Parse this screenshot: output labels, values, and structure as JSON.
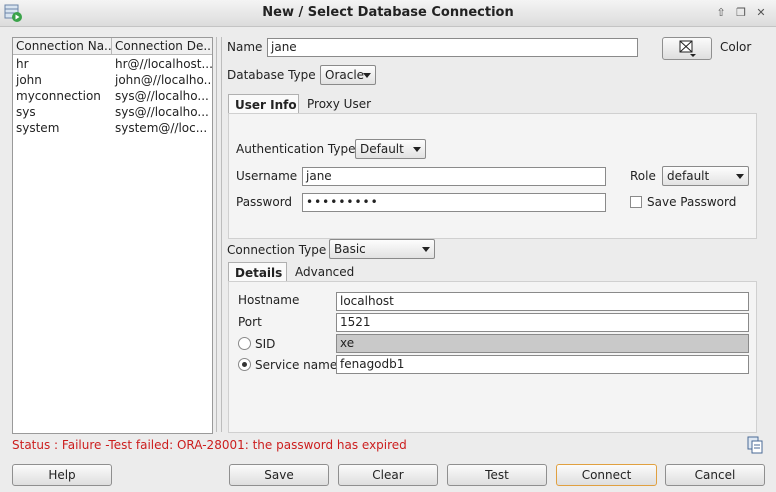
{
  "window": {
    "title": "New / Select Database Connection"
  },
  "connections": {
    "columns": [
      "Connection Na...",
      "Connection De..."
    ],
    "rows": [
      [
        "hr",
        "hr@//localhost..."
      ],
      [
        "john",
        "john@//localho..."
      ],
      [
        "myconnection",
        "sys@//localho..."
      ],
      [
        "sys",
        "sys@//localho..."
      ],
      [
        "system",
        "system@//loc..."
      ]
    ]
  },
  "form": {
    "name_label": "Name",
    "name_value": "jane",
    "color_label": "Color",
    "db_type_label": "Database Type",
    "db_type_value": "Oracle",
    "tabs": [
      "User Info",
      "Proxy User"
    ],
    "auth_type_label": "Authentication Type",
    "auth_type_value": "Default",
    "username_label": "Username",
    "username_value": "jane",
    "role_label": "Role",
    "role_value": "default",
    "password_label": "Password",
    "password_value": "•••••••••",
    "save_password_label": "Save Password",
    "connection_type_label": "Connection Type",
    "connection_type_value": "Basic",
    "conn_tabs": [
      "Details",
      "Advanced"
    ],
    "hostname_label": "Hostname",
    "hostname_value": "localhost",
    "port_label": "Port",
    "port_value": "1521",
    "sid_label": "SID",
    "sid_value": "xe",
    "service_name_label": "Service name",
    "service_name_value": "fenagodb1"
  },
  "status": {
    "text": "Status : Failure -Test failed: ORA-28001: the password has expired"
  },
  "buttons": {
    "help": "Help",
    "save": "Save",
    "clear": "Clear",
    "test": "Test",
    "connect": "Connect",
    "cancel": "Cancel"
  },
  "colors": {
    "status_error": "#cc1e1e",
    "default_button_border": "#e0a040"
  }
}
